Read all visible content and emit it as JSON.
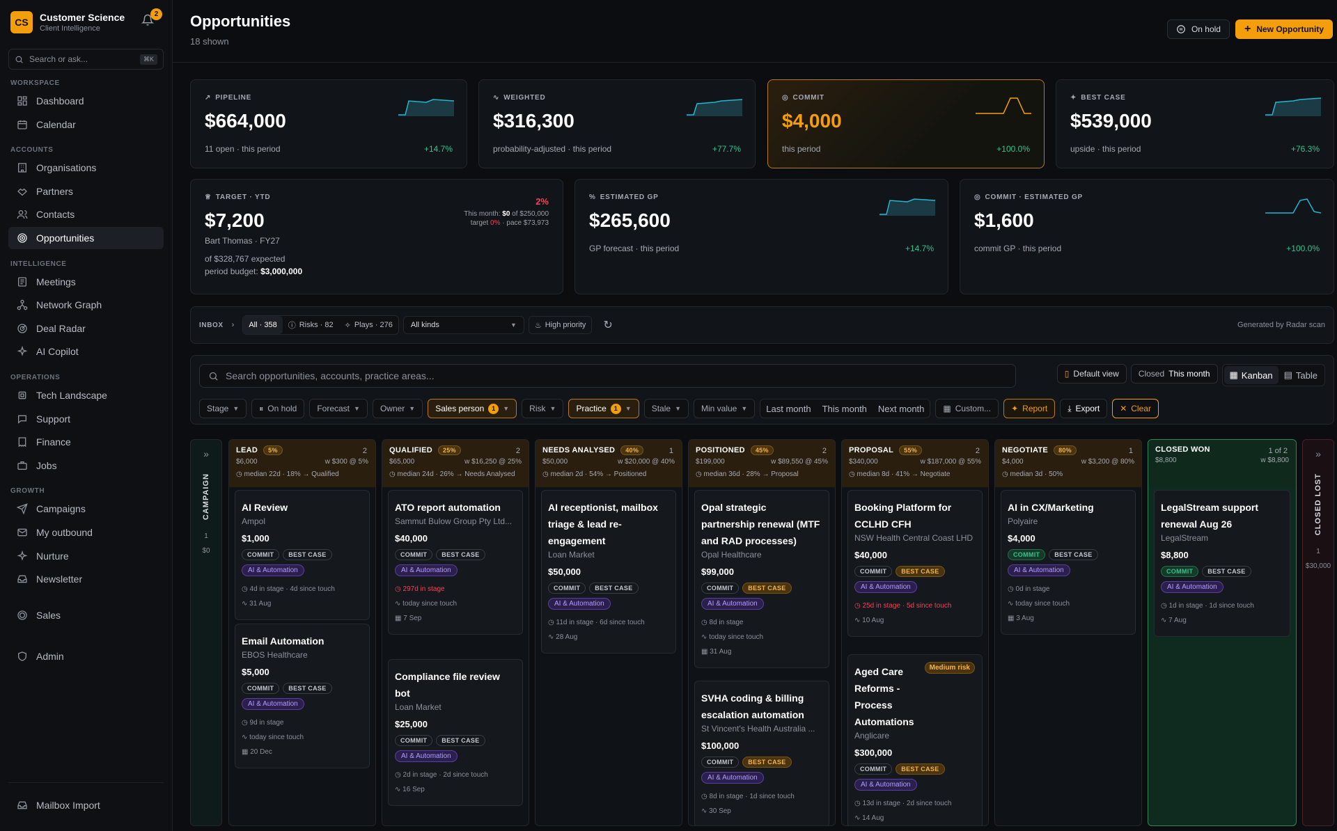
{
  "brand": {
    "logo": "CS",
    "name": "Customer Science",
    "sub": "Client Intelligence",
    "notif": "2"
  },
  "sb_search": {
    "placeholder": "Search or ask...",
    "kbd": "⌘K"
  },
  "sections": {
    "workspace": "WORKSPACE",
    "accounts": "ACCOUNTS",
    "intelligence": "INTELLIGENCE",
    "operations": "OPERATIONS",
    "growth": "GROWTH"
  },
  "nav": {
    "dashboard": "Dashboard",
    "calendar": "Calendar",
    "organisations": "Organisations",
    "partners": "Partners",
    "contacts": "Contacts",
    "opportunities": "Opportunities",
    "meetings": "Meetings",
    "network": "Network Graph",
    "radar": "Deal Radar",
    "copilot": "AI Copilot",
    "tech": "Tech Landscape",
    "support": "Support",
    "finance": "Finance",
    "jobs": "Jobs",
    "campaigns": "Campaigns",
    "outbound": "My outbound",
    "nurture": "Nurture",
    "newsletter": "Newsletter",
    "sales": "Sales",
    "admin": "Admin",
    "mailbox": "Mailbox Import"
  },
  "header": {
    "title": "Opportunities",
    "sub": "18 shown",
    "onhold": "On hold",
    "new": "New Opportunity"
  },
  "kpis": {
    "pipeline": {
      "label": "PIPELINE",
      "value": "$664,000",
      "foot": "11 open · this period",
      "delta": "+14.7%"
    },
    "weighted": {
      "label": "WEIGHTED",
      "value": "$316,300",
      "foot": "probability-adjusted · this period",
      "delta": "+77.7%"
    },
    "commit": {
      "label": "COMMIT",
      "value": "$4,000",
      "foot": "this period",
      "delta": "+100.0%"
    },
    "bestcase": {
      "label": "BEST CASE",
      "value": "$539,000",
      "foot": "upside · this period",
      "delta": "+76.3%"
    },
    "target": {
      "label": "TARGET · YTD",
      "value": "$7,200",
      "owner": "Bart Thomas · FY27",
      "exp": "of $328,767 expected",
      "budget_lbl": "period budget:",
      "budget": "$3,000,000",
      "pct": "2%",
      "m1a": "This month:",
      "m1b": "$0",
      "m1c": "of $250,000",
      "m2a": "target",
      "m2b": "0%",
      "m2c": "· pace $73,973"
    },
    "estgp": {
      "label": "ESTIMATED GP",
      "value": "$265,600",
      "foot": "GP forecast · this period",
      "delta": "+14.7%"
    },
    "commitgp": {
      "label": "COMMIT · ESTIMATED GP",
      "value": "$1,600",
      "foot": "commit GP · this period",
      "delta": "+100.0%"
    }
  },
  "inbox": {
    "label": "INBOX",
    "all": "All · 358",
    "risks": "Risks · 82",
    "plays": "Plays · 276",
    "kinds": "All kinds",
    "priority": "High priority",
    "generated": "Generated by Radar scan"
  },
  "filters": {
    "search": "Search opportunities, accounts, practice areas...",
    "default_view": "Default view",
    "closed": "Closed",
    "closed_val": "This month",
    "kanban": "Kanban",
    "table": "Table",
    "stage": "Stage",
    "onhold": "On hold",
    "forecast": "Forecast",
    "owner": "Owner",
    "salesperson": "Sales person",
    "sp_count": "1",
    "risk": "Risk",
    "practice": "Practice",
    "pr_count": "1",
    "stale": "Stale",
    "minvalue": "Min value",
    "lastmonth": "Last month",
    "thismonth": "This month",
    "nextmonth": "Next month",
    "custom": "Custom...",
    "report": "Report",
    "export": "Export",
    "clear": "Clear"
  },
  "campaign": {
    "label": "CAMPAIGN",
    "count": "1",
    "value": "$0"
  },
  "closedlost": {
    "label": "CLOSED LOST",
    "count": "1",
    "value": "$30,000"
  },
  "columns": [
    {
      "title": "LEAD",
      "pct": "5%",
      "count": "2",
      "total": "$6,000",
      "w": "w $300 @ 5%",
      "stats": "median 22d  · 18% → Qualified",
      "cards": [
        {
          "title": "AI Review",
          "acct": "Ampol",
          "value": "$1,000",
          "cm": "COMMIT",
          "bc": "BEST CASE",
          "ai": "AI & Automation",
          "m1": "4d in stage · 4d since touch",
          "m2": "31 Aug"
        },
        {
          "title": "Email Automation",
          "acct": "EBOS Healthcare",
          "value": "$5,000",
          "cm": "COMMIT",
          "bc": "BEST CASE",
          "ai": "AI & Automation",
          "m1": "9d in stage",
          "m2": "today since touch",
          "m3": "20 Dec"
        }
      ]
    },
    {
      "title": "QUALIFIED",
      "pct": "25%",
      "count": "2",
      "total": "$65,000",
      "w": "w $16,250 @ 25%",
      "stats": "median 24d · 26% → Needs Analysed",
      "cards": [
        {
          "title": "ATO report automation",
          "acct": "Sammut Bulow Group Pty Ltd...",
          "value": "$40,000",
          "cm": "COMMIT",
          "bc": "BEST CASE",
          "ai": "AI & Automation",
          "m1": "297d in stage",
          "m2": "today since touch",
          "m3": "7 Sep"
        },
        {
          "title": "Compliance file review bot",
          "acct": "Loan Market",
          "value": "$25,000",
          "cm": "COMMIT",
          "bc": "BEST CASE",
          "ai": "AI & Automation",
          "m1": "2d in stage · 2d since touch",
          "m2": "16 Sep"
        }
      ]
    },
    {
      "title": "NEEDS ANALYSED",
      "pct": "40%",
      "count": "1",
      "total": "$50,000",
      "w": "w $20,000 @ 40%",
      "stats": "median 2d · 54% → Positioned",
      "cards": [
        {
          "title": "AI receptionist, mailbox triage & lead re-engagement",
          "acct": "Loan Market",
          "value": "$50,000",
          "cm": "COMMIT",
          "bc": "BEST CASE",
          "ai": "AI & Automation",
          "m1": "11d in stage · 6d since touch",
          "m2": "28 Aug"
        }
      ]
    },
    {
      "title": "POSITIONED",
      "pct": "45%",
      "count": "2",
      "total": "$199,000",
      "w": "w $89,550 @ 45%",
      "stats": "median 36d · 28% → Proposal",
      "cards": [
        {
          "title": "Opal strategic partnership renewal (MTF and RAD processes)",
          "acct": "Opal Healthcare",
          "value": "$99,000",
          "cm": "COMMIT",
          "bc": "BEST CASE",
          "ai": "AI & Automation",
          "m1": "8d in stage",
          "m2": "today since touch",
          "m3": "31 Aug"
        },
        {
          "title": "SVHA coding & billing escalation automation",
          "acct": "St Vincent's Health Australia ...",
          "value": "$100,000",
          "cm": "COMMIT",
          "bc": "BEST CASE",
          "ai": "AI & Automation",
          "m1": "8d in stage · 1d since touch",
          "m2": "30 Sep"
        }
      ]
    },
    {
      "title": "PROPOSAL",
      "pct": "55%",
      "count": "2",
      "total": "$340,000",
      "w": "w $187,000 @ 55%",
      "stats": "median 8d · 41% → Negotiate",
      "cards": [
        {
          "title": "Booking Platform for CCLHD CFH",
          "acct": "NSW Health Central Coast LHD",
          "value": "$40,000",
          "cm": "COMMIT",
          "bc": "BEST CASE",
          "ai": "AI & Automation",
          "m1": "25d in stage · 5d since touch",
          "m2": "10 Aug"
        },
        {
          "title": "Aged Care Reforms - Process Automations",
          "acct": "Anglicare",
          "value": "$300,000",
          "cm": "COMMIT",
          "bc": "BEST CASE",
          "ai": "AI & Automation",
          "risk": "Medium risk",
          "m1": "13d in stage · 2d since touch",
          "m2": "14 Aug"
        }
      ]
    },
    {
      "title": "NEGOTIATE",
      "pct": "80%",
      "count": "1",
      "total": "$4,000",
      "w": "w $3,200 @ 80%",
      "stats": "median 3d · 50%",
      "cards": [
        {
          "title": "AI in CX/Marketing",
          "acct": "Polyaire",
          "value": "$4,000",
          "cm": "COMMIT",
          "bc": "BEST CASE",
          "ai": "AI & Automation",
          "m1": "0d in stage",
          "m2": "today since touch",
          "m3": "3 Aug"
        }
      ]
    },
    {
      "title": "CLOSED WON",
      "count": "1 of 2",
      "total": "$8,800",
      "w": "w $8,800",
      "cards": [
        {
          "title": "LegalStream support renewal Aug 26",
          "acct": "LegalStream",
          "value": "$8,800",
          "cm": "COMMIT",
          "bc": "BEST CASE",
          "ai": "AI & Automation",
          "m1": "1d in stage · 1d since touch",
          "m2": "7 Aug"
        }
      ]
    }
  ],
  "colors": {
    "accent": "#f59e0b",
    "positive": "#34c38f",
    "negative": "#f0445a",
    "ai": "#b59cff"
  }
}
